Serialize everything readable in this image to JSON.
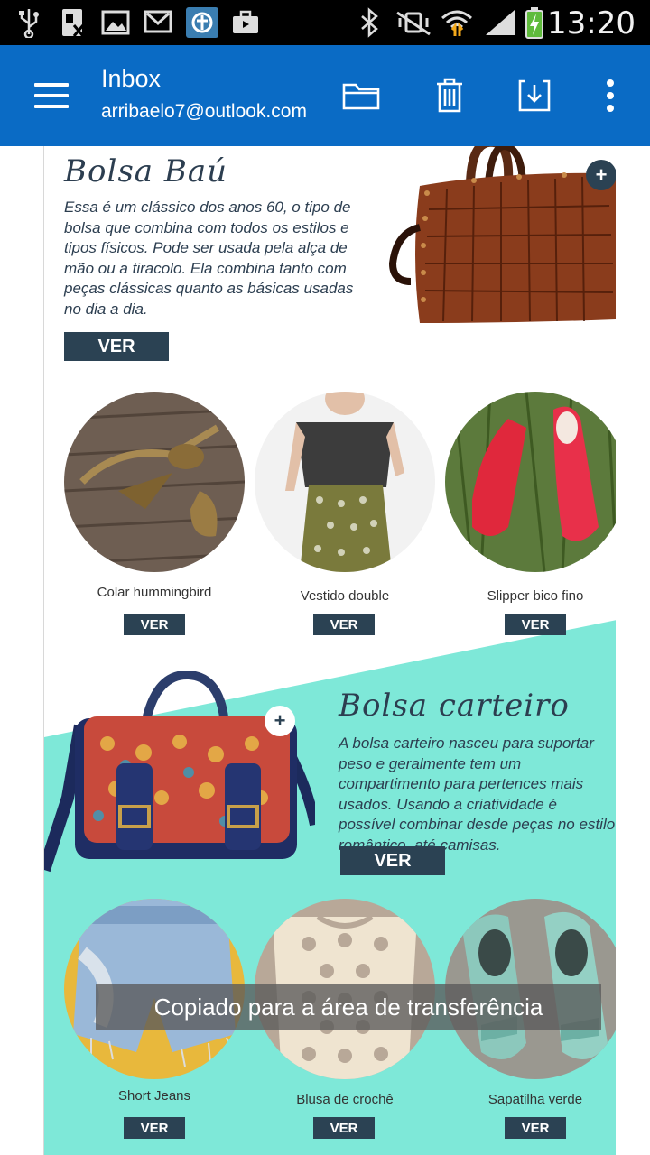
{
  "status_bar": {
    "time": "13:20"
  },
  "app_bar": {
    "title": "Inbox",
    "account": "arribaelo7@outlook.com",
    "icons": [
      "menu-icon",
      "folder-icon",
      "trash-icon",
      "archive-icon",
      "more-icon"
    ]
  },
  "email": {
    "feature1": {
      "title": "Bolsa Baú",
      "description": "Essa é um clássico dos anos 60, o tipo de bolsa que combina com todos os estilos e tipos físicos. Pode ser usada pela alça de mão ou a tiracolo. Ela combina tanto com peças clássicas quanto as básicas usadas no dia a dia.",
      "button": "VER"
    },
    "products1": [
      {
        "label": "Colar hummingbird",
        "button": "VER"
      },
      {
        "label": "Vestido double",
        "button": "VER"
      },
      {
        "label": "Slipper bico fino",
        "button": "VER"
      }
    ],
    "feature2": {
      "title": "Bolsa carteiro",
      "description": "A bolsa carteiro nasceu para suportar peso e geralmente tem um compartimento para pertences mais usados. Usando a criatividade é possível combinar desde peças no estilo romântico, até camisas.",
      "button": "VER"
    },
    "products2": [
      {
        "label": "Short Jeans",
        "button": "VER"
      },
      {
        "label": "Blusa de crochê",
        "button": "VER"
      },
      {
        "label": "Sapatilha verde",
        "button": "VER"
      }
    ]
  },
  "toast": "Copiado para a área de transferência",
  "colors": {
    "app_bar": "#0a6bc5",
    "teal": "#7ee8d8",
    "button": "#2b4253"
  }
}
